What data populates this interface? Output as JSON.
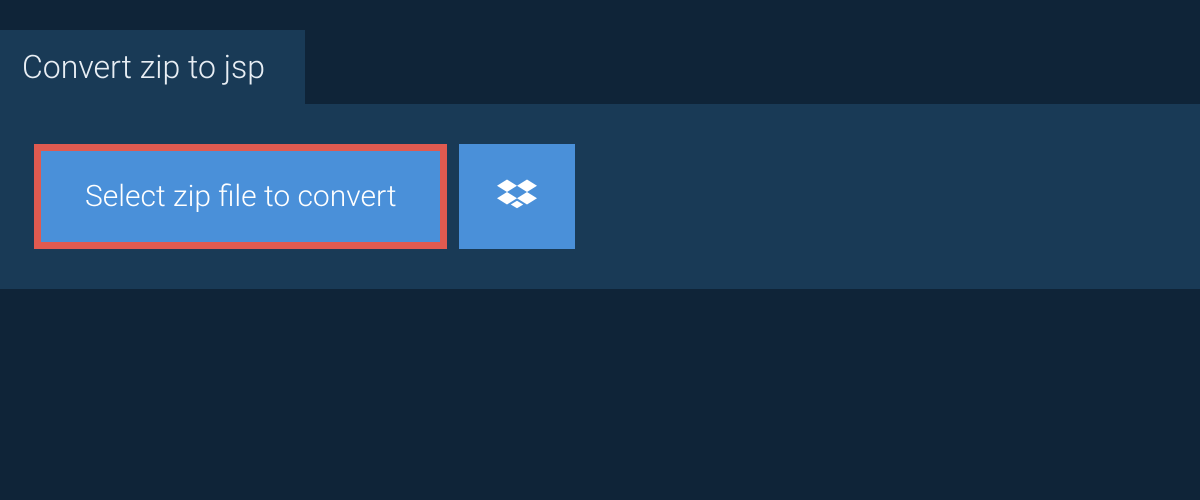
{
  "header": {
    "tab_title": "Convert zip to jsp"
  },
  "main": {
    "select_button_label": "Select zip file to convert"
  },
  "colors": {
    "background": "#0f2438",
    "panel": "#193a56",
    "button_primary": "#4a90d9",
    "highlight_border": "#e05a50",
    "text_light": "#e8eef4"
  }
}
